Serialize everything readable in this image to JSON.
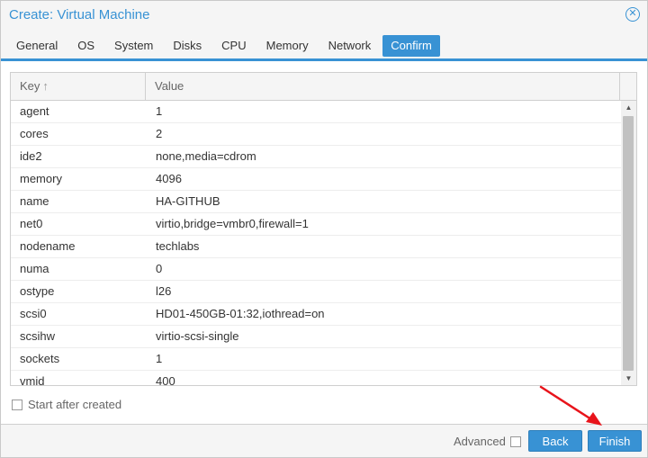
{
  "window": {
    "title": "Create: Virtual Machine"
  },
  "tabs": [
    {
      "label": "General"
    },
    {
      "label": "OS"
    },
    {
      "label": "System"
    },
    {
      "label": "Disks"
    },
    {
      "label": "CPU"
    },
    {
      "label": "Memory"
    },
    {
      "label": "Network"
    },
    {
      "label": "Confirm",
      "active": true
    }
  ],
  "grid": {
    "columns": {
      "key": "Key",
      "value": "Value"
    },
    "sort_indicator": "↑",
    "rows": [
      {
        "key": "agent",
        "value": "1"
      },
      {
        "key": "cores",
        "value": "2"
      },
      {
        "key": "ide2",
        "value": "none,media=cdrom"
      },
      {
        "key": "memory",
        "value": "4096"
      },
      {
        "key": "name",
        "value": "HA-GITHUB"
      },
      {
        "key": "net0",
        "value": "virtio,bridge=vmbr0,firewall=1"
      },
      {
        "key": "nodename",
        "value": "techlabs"
      },
      {
        "key": "numa",
        "value": "0"
      },
      {
        "key": "ostype",
        "value": "l26"
      },
      {
        "key": "scsi0",
        "value": "HD01-450GB-01:32,iothread=on"
      },
      {
        "key": "scsihw",
        "value": "virtio-scsi-single"
      },
      {
        "key": "sockets",
        "value": "1"
      },
      {
        "key": "vmid",
        "value": "400"
      }
    ]
  },
  "options": {
    "start_after_created": "Start after created"
  },
  "footer": {
    "advanced_label": "Advanced",
    "back_label": "Back",
    "finish_label": "Finish"
  },
  "icons": {
    "close": "close-icon",
    "sort": "sort-ascending-icon",
    "annotation": "red-arrow"
  },
  "colors": {
    "accent": "#3892d4",
    "annotation": "#e8141b"
  }
}
